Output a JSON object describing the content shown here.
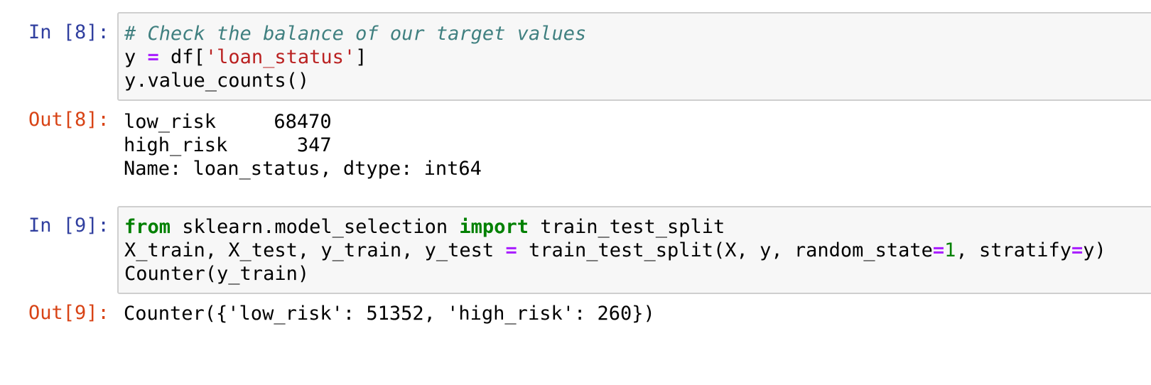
{
  "cells": [
    {
      "in_prompt": "In [8]:",
      "code": {
        "line1": {
          "comment": "# Check the balance of our target values"
        },
        "line2": {
          "t1": "y ",
          "t2": "=",
          "t3": " df[",
          "t4": "'loan_status'",
          "t5": "]"
        },
        "line3": {
          "t1": "y.value_counts()"
        }
      },
      "out_prompt": "Out[8]:",
      "output": [
        "low_risk     68470",
        "high_risk      347",
        "Name: loan_status, dtype: int64"
      ]
    },
    {
      "in_prompt": "In [9]:",
      "code": {
        "line1": {
          "t1": "from",
          "t2": " sklearn.model_selection ",
          "t3": "import",
          "t4": " train_test_split"
        },
        "line2": {
          "t1": "X_train, X_test, y_train, y_test ",
          "t2": "=",
          "t3": " train_test_split(X, y, random_state",
          "t4": "=",
          "t5": "1",
          "t6": ", stratify",
          "t7": "=",
          "t8": "y)"
        },
        "line3": {
          "t1": "Counter(y_train)"
        }
      },
      "out_prompt": "Out[9]:",
      "output": [
        "Counter({'low_risk': 51352, 'high_risk': 260})"
      ]
    }
  ]
}
